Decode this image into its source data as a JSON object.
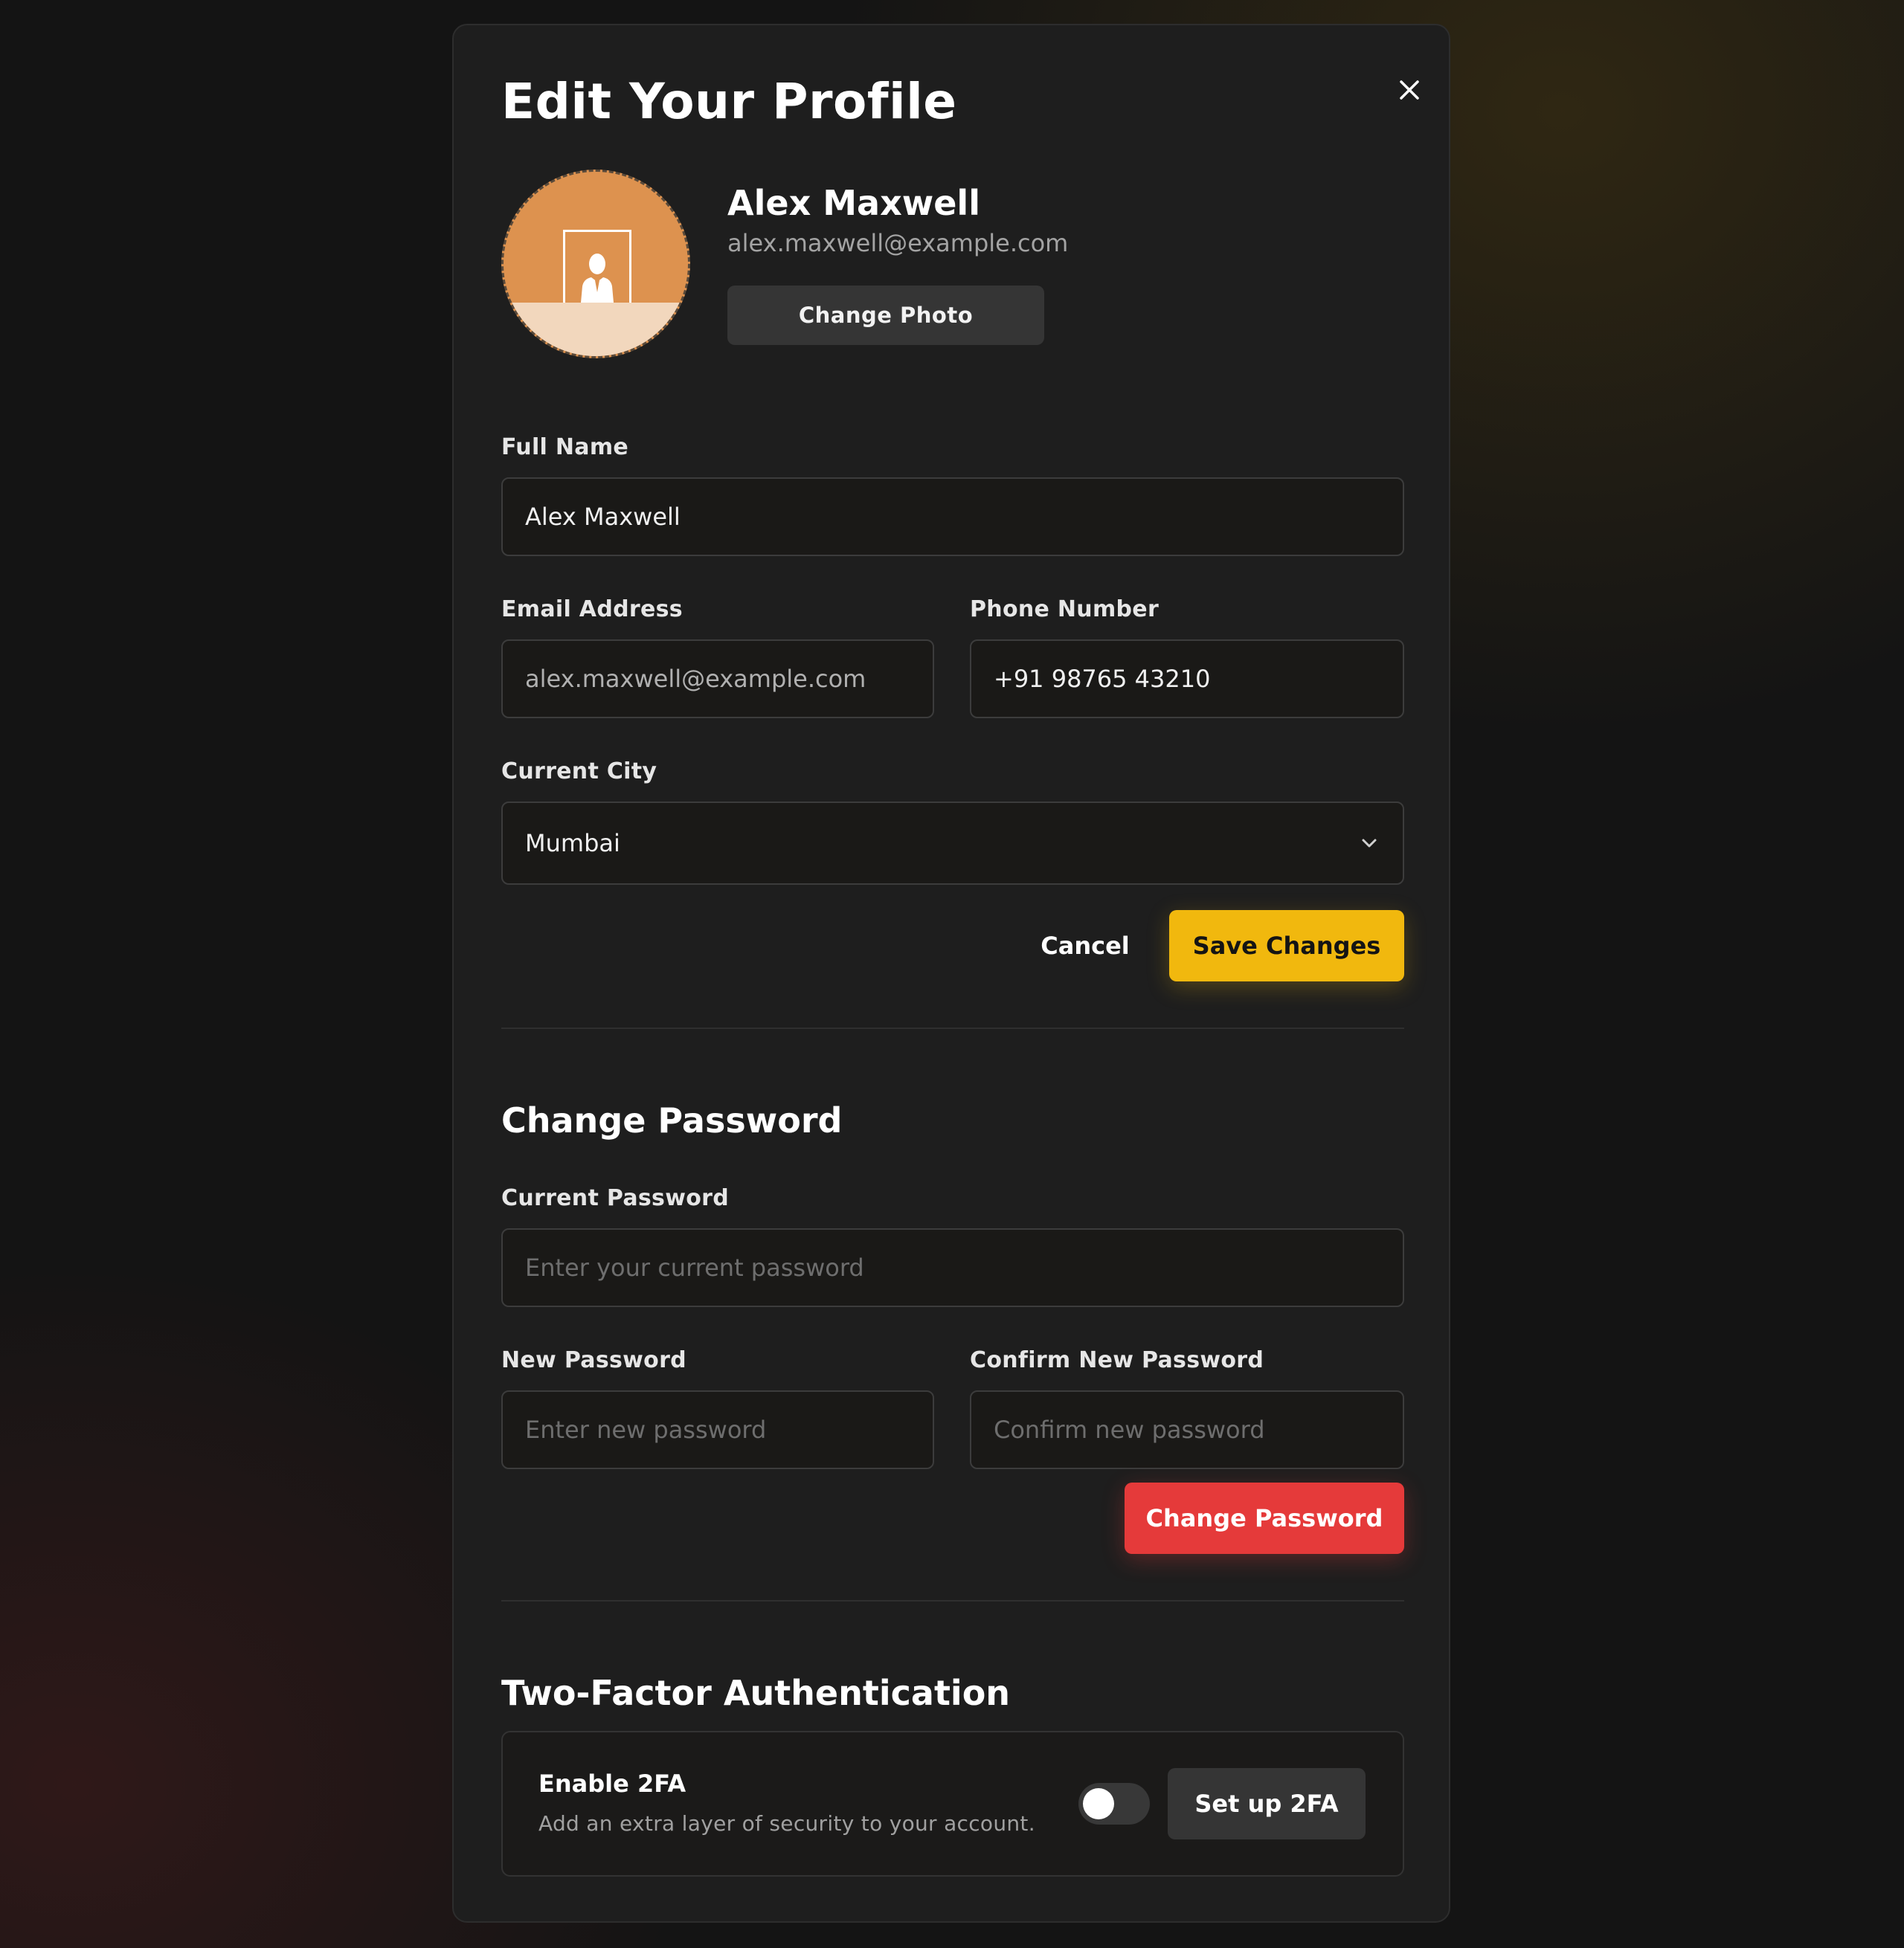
{
  "modal": {
    "title": "Edit Your Profile",
    "close_icon": "close-icon"
  },
  "profile": {
    "name": "Alex Maxwell",
    "email": "alex.maxwell@example.com",
    "change_photo_label": "Change Photo",
    "avatar_icon": "person-silhouette-icon"
  },
  "form": {
    "full_name_label": "Full Name",
    "full_name_value": "Alex Maxwell",
    "email_label": "Email Address",
    "email_value": "alex.maxwell@example.com",
    "phone_label": "Phone Number",
    "phone_value": "+91 98765 43210",
    "city_label": "Current City",
    "city_value": "Mumbai",
    "cancel_label": "Cancel",
    "save_label": "Save Changes"
  },
  "password": {
    "section_title": "Change Password",
    "current_label": "Current Password",
    "current_placeholder": "Enter your current password",
    "new_label": "New Password",
    "new_placeholder": "Enter new password",
    "confirm_label": "Confirm New Password",
    "confirm_placeholder": "Confirm new password",
    "submit_label": "Change Password"
  },
  "twofa": {
    "section_title": "Two-Factor Authentication",
    "title": "Enable 2FA",
    "description": "Add an extra layer of security to your account.",
    "enabled": false,
    "setup_label": "Set up 2FA"
  },
  "colors": {
    "accent_yellow": "#f1b80e",
    "danger_red": "#e53a3a",
    "avatar_orange": "#dd924f"
  }
}
